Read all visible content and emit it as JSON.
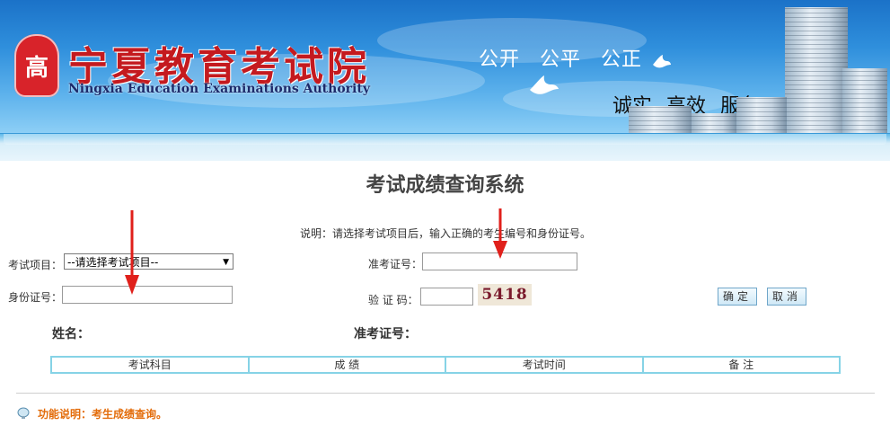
{
  "header": {
    "logo_seal": "高",
    "logo_cn": "宁夏教育考试院",
    "logo_en": "Ningxia Education Examinations Authority",
    "slogan_top": [
      "公开",
      "公平",
      "公正"
    ],
    "slogan_bottom": [
      "诚实",
      "高效",
      "服务"
    ]
  },
  "page": {
    "title": "考试成绩查询系统",
    "instruction": "说明：请选择考试项目后，输入正确的考生编号和身份证号。"
  },
  "form": {
    "exam_item_label": "考试项目：",
    "exam_item_selected": "--请选择考试项目--",
    "admission_label": "准考证号：",
    "admission_value": "",
    "id_label": "身份证号：",
    "id_value": "",
    "captcha_label": "验 证 码：",
    "captcha_value": "",
    "captcha_image_text": "5418",
    "confirm_label": "确定",
    "cancel_label": "取消"
  },
  "result": {
    "name_label": "姓名：",
    "admission_label": "准考证号：",
    "columns": [
      "考试科目",
      "成 绩",
      "考试时间",
      "备 注"
    ]
  },
  "footer": {
    "function_note": "功能说明：考生成绩查询。"
  },
  "colors": {
    "banner_blue": "#2f8fdc",
    "seal_red": "#d8232a",
    "table_border": "#86d3e6",
    "note_orange": "#e36c0a",
    "arrow_red": "#e0201b"
  }
}
